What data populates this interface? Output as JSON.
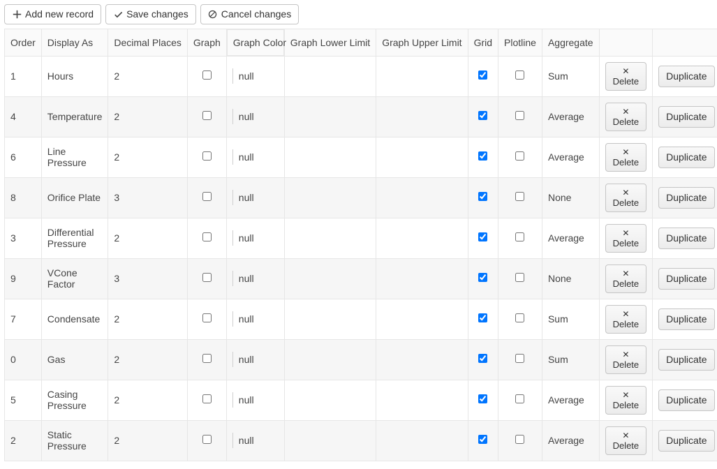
{
  "toolbar": {
    "add_label": "Add new record",
    "save_label": "Save changes",
    "cancel_label": "Cancel changes"
  },
  "columns": {
    "order": "Order",
    "display_as": "Display As",
    "decimal_places": "Decimal Places",
    "graph": "Graph",
    "graph_color": "Graph Color",
    "graph_lower_limit": "Graph Lower Limit",
    "graph_upper_limit": "Graph Upper Limit",
    "grid": "Grid",
    "plotline": "Plotline",
    "aggregate": "Aggregate"
  },
  "actions": {
    "delete_label": "Delete",
    "duplicate_label": "Duplicate"
  },
  "null_text": "null",
  "rows": [
    {
      "order": "1",
      "display_as": "Hours",
      "decimal_places": "2",
      "graph": false,
      "graph_color": "null",
      "lower": "",
      "upper": "",
      "grid": true,
      "plotline": false,
      "aggregate": "Sum"
    },
    {
      "order": "4",
      "display_as": "Temperature",
      "decimal_places": "2",
      "graph": false,
      "graph_color": "null",
      "lower": "",
      "upper": "",
      "grid": true,
      "plotline": false,
      "aggregate": "Average"
    },
    {
      "order": "6",
      "display_as": "Line Pressure",
      "decimal_places": "2",
      "graph": false,
      "graph_color": "null",
      "lower": "",
      "upper": "",
      "grid": true,
      "plotline": false,
      "aggregate": "Average"
    },
    {
      "order": "8",
      "display_as": "Orifice Plate",
      "decimal_places": "3",
      "graph": false,
      "graph_color": "null",
      "lower": "",
      "upper": "",
      "grid": true,
      "plotline": false,
      "aggregate": "None"
    },
    {
      "order": "3",
      "display_as": "Differential Pressure",
      "decimal_places": "2",
      "graph": false,
      "graph_color": "null",
      "lower": "",
      "upper": "",
      "grid": true,
      "plotline": false,
      "aggregate": "Average"
    },
    {
      "order": "9",
      "display_as": "VCone Factor",
      "decimal_places": "3",
      "graph": false,
      "graph_color": "null",
      "lower": "",
      "upper": "",
      "grid": true,
      "plotline": false,
      "aggregate": "None"
    },
    {
      "order": "7",
      "display_as": "Condensate",
      "decimal_places": "2",
      "graph": false,
      "graph_color": "null",
      "lower": "",
      "upper": "",
      "grid": true,
      "plotline": false,
      "aggregate": "Sum"
    },
    {
      "order": "0",
      "display_as": "Gas",
      "decimal_places": "2",
      "graph": false,
      "graph_color": "null",
      "lower": "",
      "upper": "",
      "grid": true,
      "plotline": false,
      "aggregate": "Sum"
    },
    {
      "order": "5",
      "display_as": "Casing Pressure",
      "decimal_places": "2",
      "graph": false,
      "graph_color": "null",
      "lower": "",
      "upper": "",
      "grid": true,
      "plotline": false,
      "aggregate": "Average"
    },
    {
      "order": "2",
      "display_as": "Static Pressure",
      "decimal_places": "2",
      "graph": false,
      "graph_color": "null",
      "lower": "",
      "upper": "",
      "grid": true,
      "plotline": false,
      "aggregate": "Average"
    }
  ]
}
